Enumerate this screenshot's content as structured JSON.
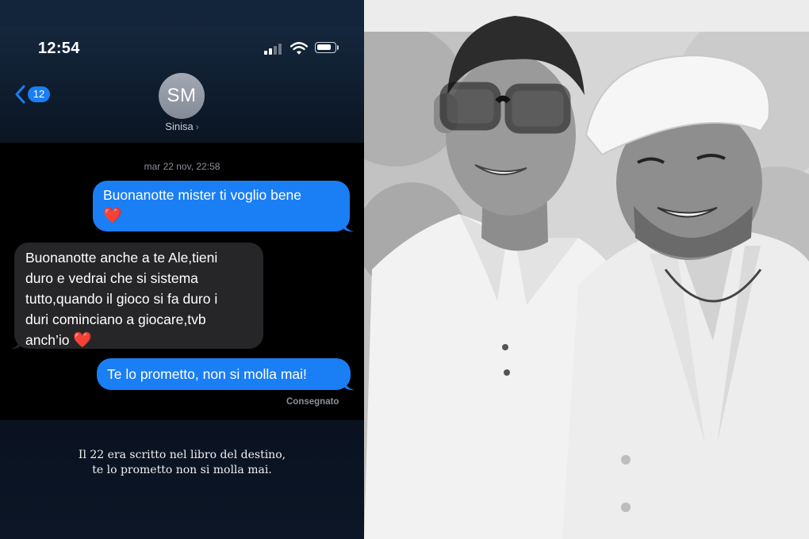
{
  "status_bar": {
    "time": "12:54",
    "icons": [
      "cellular-signal-icon",
      "wifi-icon",
      "battery-icon"
    ]
  },
  "nav": {
    "back_count": "12",
    "avatar_initials": "SM",
    "contact_name": "Sinisa",
    "contact_chevron": "›"
  },
  "conversation": {
    "timestamp": "mar 22 nov, 22:58",
    "messages": [
      {
        "direction": "sent",
        "text": "Buonanotte mister ti voglio bene",
        "emoji": "❤️"
      },
      {
        "direction": "received",
        "lines": [
          "Buonanotte anche a te Ale,tieni",
          "duro e vedrai che si sistema",
          "tutto,quando il gioco si fa duro i",
          "duri cominciano a giocare,tvb",
          "anch’io"
        ],
        "emoji": "❤️"
      },
      {
        "direction": "sent",
        "text": "Te lo prometto, non si molla mai!"
      }
    ],
    "delivery_status": "Consegnato"
  },
  "caption": {
    "lines": [
      "Il 22 era scritto nel libro del destino,",
      "te lo prometto non si molla mai."
    ]
  },
  "colors": {
    "sent_bubble": "#1a7ef5",
    "received_bubble": "#262628",
    "header": "#13253a",
    "heart": "#e0243a"
  }
}
